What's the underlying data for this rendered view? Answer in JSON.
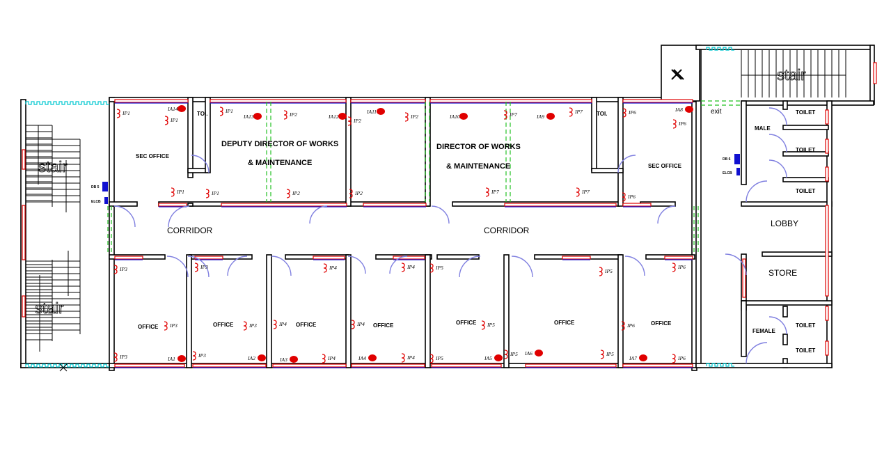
{
  "plan": {
    "rooms": {
      "sec_office_left": "SEC OFFICE",
      "toilet_left": "TOI.",
      "deputy_line1": "DEPUTY DIRECTOR OF WORKS",
      "deputy_line2": "& MAINTENANCE",
      "director_line1": "DIRECTOR OF WORKS",
      "director_line2": "& MAINTENANCE",
      "toilet_right": "TOI.",
      "sec_office_right": "SEC OFFICE",
      "corridor_left": "CORRIDOR",
      "corridor_right": "CORRIDOR",
      "offices": [
        "OFFICE",
        "OFFICE",
        "OFFICE",
        "OFFICE",
        "OFFICE",
        "OFFICE",
        "OFFICE"
      ],
      "male": "MALE",
      "male_toilets": [
        "TOILET",
        "TOILET",
        "TOILET"
      ],
      "lobby": "LOBBY",
      "store": "STORE",
      "female": "FEMALE",
      "female_toilets": [
        "TOILET",
        "TOILET"
      ],
      "exit": "exit",
      "stair_left_top": "stair",
      "stair_left_bottom": "stair",
      "stair_right": "stair"
    },
    "panels": [
      {
        "db": "DB 5",
        "elcb": "ELCB"
      },
      {
        "db": "DB 6",
        "elcb": "ELCB"
      }
    ],
    "fixtures": [
      {
        "label": "IP1",
        "type": "light"
      },
      {
        "label": "IA14",
        "type": "ac"
      },
      {
        "label": "IP1",
        "type": "light"
      },
      {
        "label": "IP1",
        "type": "light"
      },
      {
        "label": "IA13",
        "type": "ac"
      },
      {
        "label": "IP2",
        "type": "light"
      },
      {
        "label": "IA12",
        "type": "ac"
      },
      {
        "label": "IA11",
        "type": "ac"
      },
      {
        "label": "IP2",
        "type": "light"
      },
      {
        "label": "IP2",
        "type": "light"
      },
      {
        "label": "IA10",
        "type": "ac"
      },
      {
        "label": "IP7",
        "type": "light"
      },
      {
        "label": "IA9",
        "type": "ac"
      },
      {
        "label": "IP7",
        "type": "light"
      },
      {
        "label": "IP6",
        "type": "light"
      },
      {
        "label": "IA8",
        "type": "ac"
      },
      {
        "label": "IP6",
        "type": "light"
      },
      {
        "label": "IP1",
        "type": "light"
      },
      {
        "label": "IP1",
        "type": "light"
      },
      {
        "label": "IP2",
        "type": "light"
      },
      {
        "label": "IP2",
        "type": "light"
      },
      {
        "label": "IP7",
        "type": "light"
      },
      {
        "label": "IP7",
        "type": "light"
      },
      {
        "label": "IP6",
        "type": "light"
      },
      {
        "label": "IP3",
        "type": "light"
      },
      {
        "label": "IP3",
        "type": "light"
      },
      {
        "label": "IP4",
        "type": "light"
      },
      {
        "label": "IP4",
        "type": "light"
      },
      {
        "label": "IP5",
        "type": "light"
      },
      {
        "label": "IP5",
        "type": "light"
      },
      {
        "label": "IP6",
        "type": "light"
      },
      {
        "label": "IP3",
        "type": "light"
      },
      {
        "label": "IP3",
        "type": "light"
      },
      {
        "label": "IP4",
        "type": "light"
      },
      {
        "label": "IP4",
        "type": "light"
      },
      {
        "label": "IP5",
        "type": "light"
      },
      {
        "label": "IP6",
        "type": "light"
      },
      {
        "label": "IP3",
        "type": "light"
      },
      {
        "label": "IA1",
        "type": "ac"
      },
      {
        "label": "IP3",
        "type": "light"
      },
      {
        "label": "IA2",
        "type": "ac"
      },
      {
        "label": "IA3",
        "type": "ac"
      },
      {
        "label": "IP4",
        "type": "light"
      },
      {
        "label": "IA4",
        "type": "ac"
      },
      {
        "label": "IP4",
        "type": "light"
      },
      {
        "label": "IP5",
        "type": "light"
      },
      {
        "label": "IA5",
        "type": "ac"
      },
      {
        "label": "IP5",
        "type": "light"
      },
      {
        "label": "IA6",
        "type": "ac"
      },
      {
        "label": "IP5",
        "type": "light"
      },
      {
        "label": "IA7",
        "type": "ac"
      },
      {
        "label": "IP6",
        "type": "light"
      }
    ],
    "colors": {
      "wall": "#000000",
      "window": "#e00000",
      "door": "#8080e0",
      "opening": "#22c022",
      "balcony": "#00c8d0",
      "panel": "#1010d0"
    }
  }
}
